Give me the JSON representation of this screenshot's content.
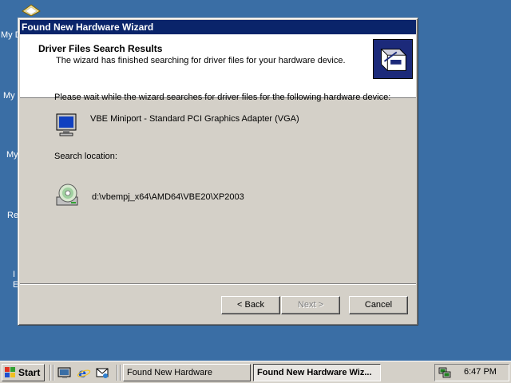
{
  "desktop": {
    "fragments": [
      "My D",
      "My",
      "My",
      "Re",
      "I",
      "E"
    ]
  },
  "window": {
    "title": "Found New Hardware Wizard",
    "header_title": "Driver Files Search Results",
    "header_subtitle": "The wizard has finished searching for driver files for your hardware device.",
    "wait_text": "Please wait while the wizard searches for driver files for the following hardware device:",
    "device_name": "VBE Miniport - Standard PCI Graphics Adapter (VGA)",
    "search_location_label": "Search location:",
    "search_path": "d:\\vbempj_x64\\AMD64\\VBE20\\XP2003",
    "buttons": {
      "back": "< Back",
      "next": "Next >",
      "cancel": "Cancel"
    }
  },
  "taskbar": {
    "start_label": "Start",
    "tasks": [
      {
        "label": "Found New Hardware",
        "active": false
      },
      {
        "label": "Found New Hardware Wiz...",
        "active": true
      }
    ],
    "clock": "6:47 PM"
  },
  "colors": {
    "desktop": "#3a6ea5",
    "titlebar": "#0a246a",
    "face": "#d4d0c8"
  }
}
